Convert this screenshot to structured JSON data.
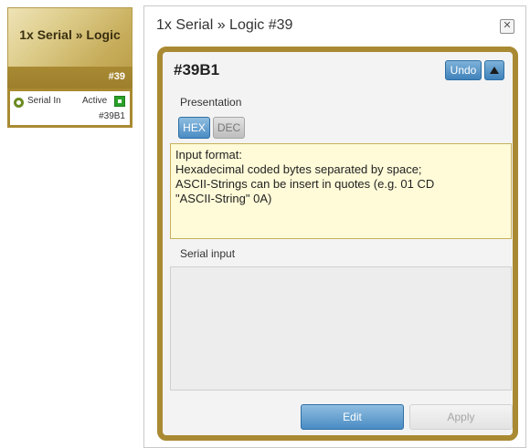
{
  "node": {
    "title": "1x Serial » Logic",
    "id": "#39",
    "input_label": "Serial In",
    "active_label": "Active",
    "sub_id": "#39B1"
  },
  "window": {
    "title": "1x Serial » Logic #39",
    "close_icon": "close-icon"
  },
  "panel": {
    "id": "#39B1",
    "undo_label": "Undo",
    "up_icon": "arrow-up-icon",
    "presentation_label": "Presentation",
    "modes": [
      "HEX",
      "DEC"
    ],
    "selected_mode": "HEX",
    "info_lines": [
      "Input format:",
      "Hexadecimal coded bytes separated by space;",
      "ASCII-Strings can be insert in quotes  (e.g. 01 CD",
      "\"ASCII-String\" 0A)"
    ],
    "serial_input_label": "Serial input",
    "serial_input_value": "",
    "edit_label": "Edit",
    "apply_label": "Apply"
  },
  "colors": {
    "gold": "#a98a33",
    "blue": "#4a8cc4",
    "info_bg": "#fffbd8",
    "active_green": "#2aa12a"
  }
}
